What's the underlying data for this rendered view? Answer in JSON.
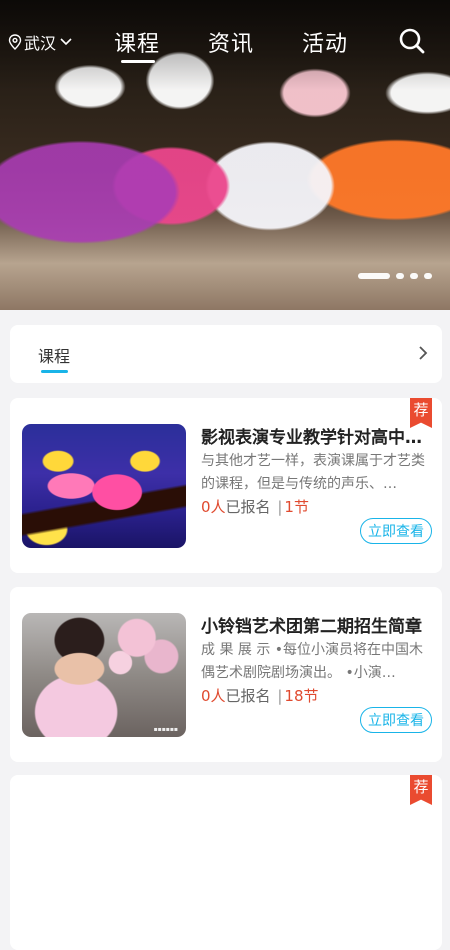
{
  "nav": {
    "location": "武汉",
    "tabs": [
      "课程",
      "资讯",
      "活动"
    ],
    "active_tab": "课程",
    "icons": {
      "location": "location-pin-icon",
      "dropdown": "chevron-down-icon",
      "search": "search-icon"
    }
  },
  "banner": {
    "dots": 4,
    "active_dot": 1
  },
  "section": {
    "title": "课程",
    "accent": "#19b4e8"
  },
  "courses": [
    {
      "title": "影视表演专业教学针对高中…",
      "desc": "与其他才艺一样，表演课属于才艺类的课程，但是与传统的声乐、…",
      "enrolled_count": "0人",
      "enrolled_label": "已报名",
      "sep": "|",
      "lessons": "1节",
      "button": "立即查看",
      "badge": "荐"
    },
    {
      "title": "小铃铛艺术团第二期招生简章",
      "desc": "成 果 展 示 •每位小演员将在中国木偶艺术剧院剧场演出。 •小演…",
      "enrolled_count": "0人",
      "enrolled_label": "已报名",
      "sep": "|",
      "lessons": "18节",
      "button": "立即查看",
      "badge": ""
    },
    {
      "badge": "荐"
    }
  ],
  "colors": {
    "accent": "#19b4e8",
    "badge": "#ea4b30",
    "red_text": "#e04a2f"
  }
}
